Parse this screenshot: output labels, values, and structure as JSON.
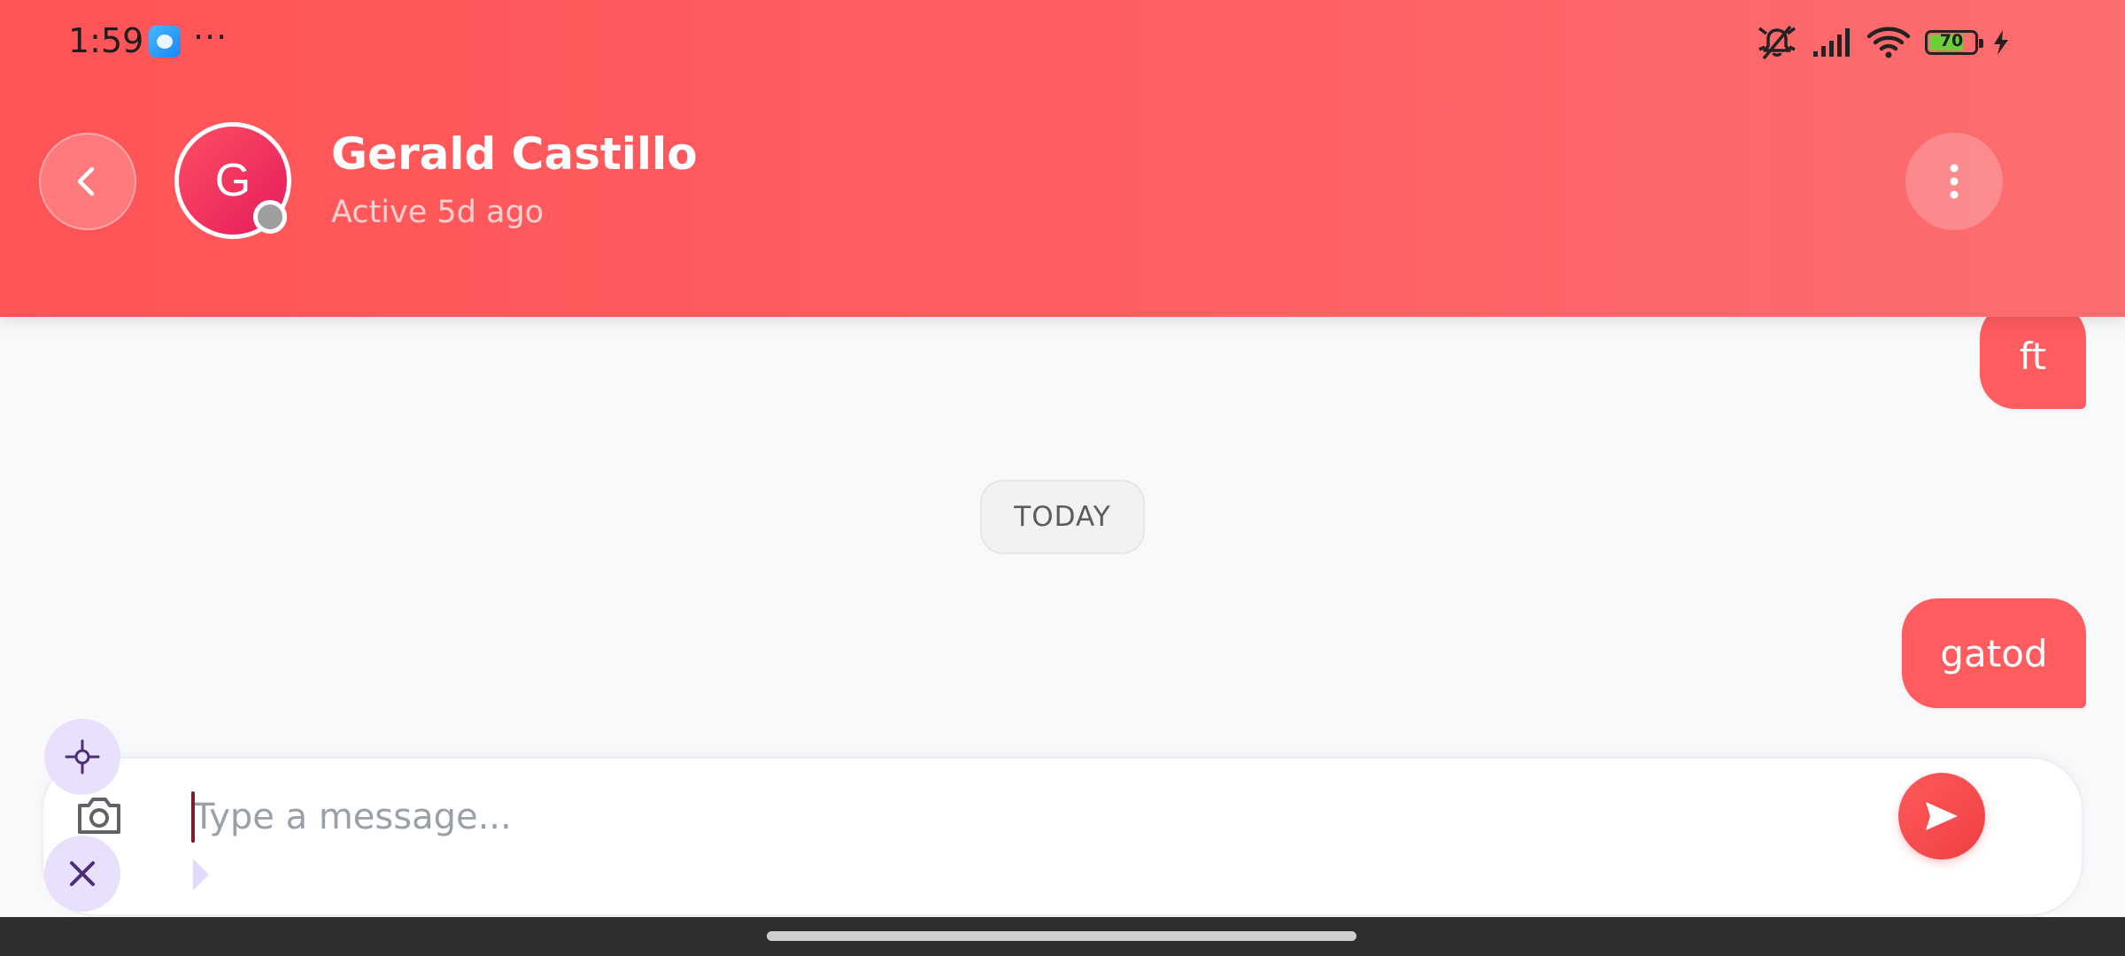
{
  "status_bar": {
    "time": "1:59",
    "more": "···",
    "battery_level": "70",
    "icons": [
      "app-icon",
      "muted-bell-icon",
      "signal-icon",
      "wifi-icon",
      "battery-icon",
      "charging-icon"
    ]
  },
  "header": {
    "contact_initial": "G",
    "contact_name": "Gerald Castillo",
    "contact_status": "Active 5d ago",
    "icons": [
      "back-arrow-icon",
      "more-vertical-icon"
    ],
    "colors": {
      "header_start": "#ff5457",
      "header_end": "#fc6d6f",
      "presence": "#9e9e9e"
    }
  },
  "chat": {
    "date_separator": "TODAY",
    "messages": [
      {
        "text": "ft",
        "sender": "me"
      },
      {
        "text": "gatod",
        "sender": "me"
      }
    ],
    "colors": {
      "bubble": "#ff5c5f",
      "bubble_text": "#ffffff"
    }
  },
  "composer": {
    "placeholder": "Type a message...",
    "value": "",
    "icons": [
      "crosshair-icon",
      "camera-icon",
      "close-icon",
      "send-icon"
    ],
    "colors": {
      "fab_bg": "#e9e0fc",
      "fab_icon": "#4b2c7d",
      "send": "#ef3f44"
    }
  }
}
